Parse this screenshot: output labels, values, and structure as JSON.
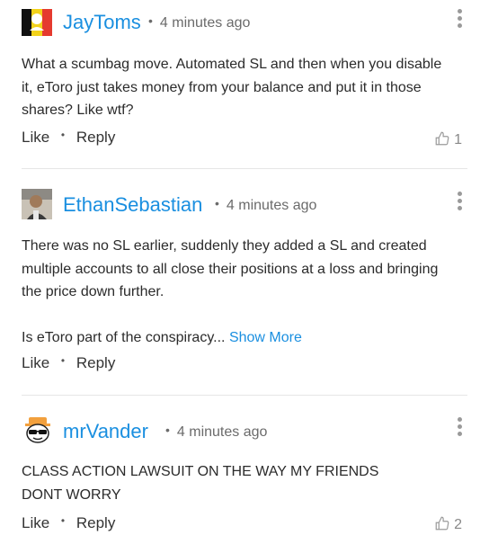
{
  "comments": [
    {
      "author": "JayToms",
      "time": "4 minutes ago",
      "paragraphs": [
        "What a scumbag move. Automated SL and then when you disable it, eToro just takes money from your balance and put it in those shares? Like wtf?"
      ],
      "show_more": "",
      "like_label": "Like",
      "reply_label": "Reply",
      "likes": "1",
      "avatar_icon": "flag-avatar-icon"
    },
    {
      "author": "EthanSebastian",
      "time": "4 minutes ago",
      "paragraphs": [
        "There was no SL earlier, suddenly they added a SL and created multiple accounts to all close their positions at a loss and bringing the price down further.",
        "Is eToro part of the conspiracy..."
      ],
      "show_more": "Show More",
      "like_label": "Like",
      "reply_label": "Reply",
      "likes": "",
      "avatar_icon": "photo-avatar-icon"
    },
    {
      "author": "mrVander",
      "time": "4 minutes ago",
      "paragraphs": [
        "CLASS ACTION LAWSUIT ON THE WAY MY FRIENDS DONT WORRY"
      ],
      "show_more": "",
      "like_label": "Like",
      "reply_label": "Reply",
      "likes": "2",
      "avatar_icon": "sunglasses-avatar-icon"
    }
  ],
  "colors": {
    "author": "#1a8fe0",
    "link": "#1a8fe0",
    "muted": "#6b6b6b"
  }
}
